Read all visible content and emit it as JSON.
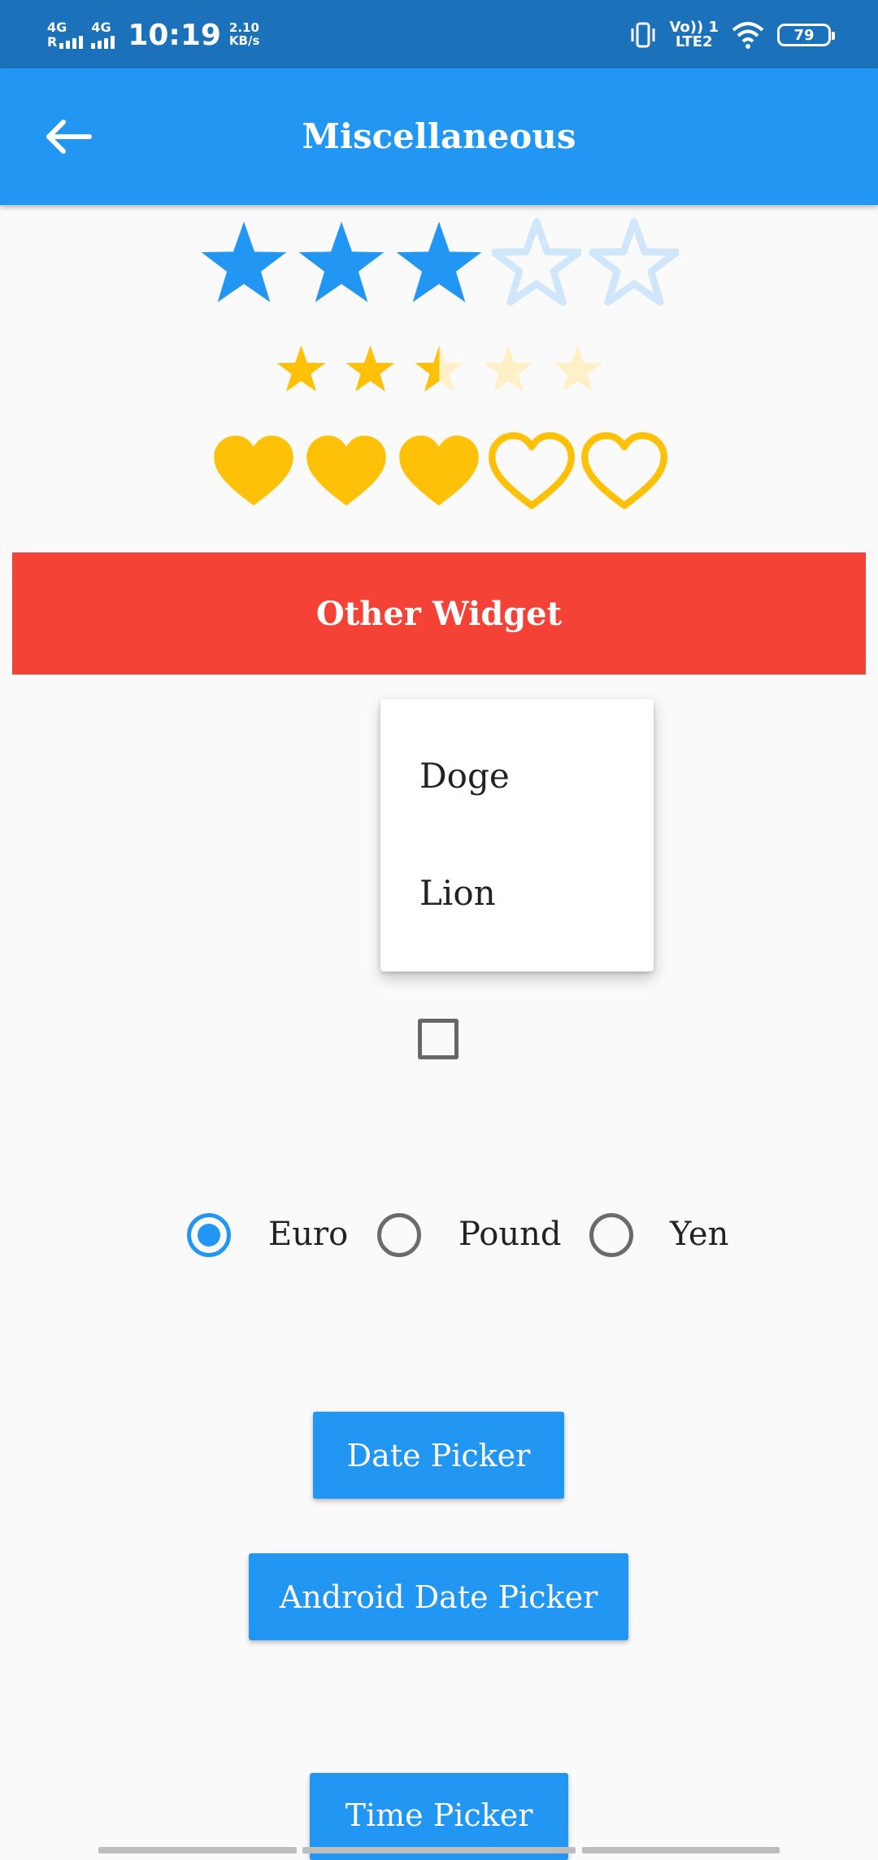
{
  "status_bar": {
    "net1_label": "4G",
    "net1_sub": "R",
    "net2_label": "4G",
    "time": "10:19",
    "speed_value": "2.10",
    "speed_unit": "KB/s",
    "volte_top": "Vo)) 1",
    "volte_bottom": "LTE2",
    "battery": "79"
  },
  "app_bar": {
    "title": "Miscellaneous",
    "back_icon": "arrow-left-icon"
  },
  "ratings": {
    "stars_large": {
      "value": 3,
      "max": 5,
      "color": "#2196f3",
      "empty_color": "#cfe6fb"
    },
    "stars_small": {
      "value": 2.5,
      "max": 5,
      "color": "#ffc107",
      "empty_color": "#fff0c8"
    },
    "hearts": {
      "value": 3,
      "max": 5,
      "color": "#ffc107"
    }
  },
  "banner": {
    "label": "Other Widget",
    "color": "#f44336"
  },
  "dropdown": {
    "items": [
      "Doge",
      "Lion"
    ]
  },
  "checkbox": {
    "checked": false
  },
  "radio_group": {
    "options": [
      "Euro",
      "Pound",
      "Yen"
    ],
    "selected": "Euro"
  },
  "buttons": {
    "date_picker": "Date Picker",
    "android_date_picker": "Android Date Picker",
    "time_picker": "Time Picker"
  },
  "colors": {
    "status_bar": "#1b72ba",
    "primary": "#2196f3",
    "background": "#fafafa"
  }
}
